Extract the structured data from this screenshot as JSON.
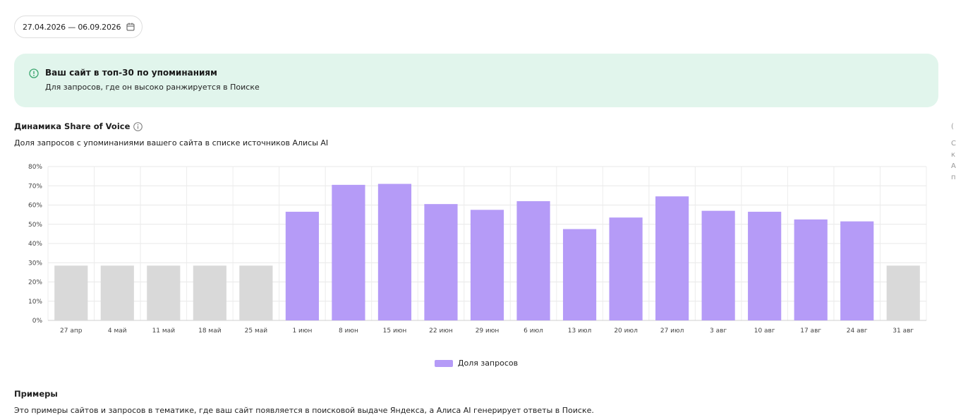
{
  "date_range": {
    "value": "27.04.2026 — 06.09.2026",
    "icon": "calendar-icon"
  },
  "alert": {
    "icon": "check-circle-icon",
    "title": "Ваш сайт в топ-30 по упоминаниям",
    "subtitle": "Для запросов, где он высоко ранжируется в Поиске",
    "background": "#e1f5ec",
    "accent": "#3aa56e"
  },
  "sov_section": {
    "title": "Динамика Share of Voice",
    "info_icon": "info-icon",
    "subtitle": "Доля запросов с упоминаниями вашего сайта в списке источников Алисы AI"
  },
  "chart_data": {
    "type": "bar",
    "categories": [
      "27 апр",
      "4 май",
      "11 май",
      "18 май",
      "25 май",
      "1 июн",
      "8 июн",
      "15 июн",
      "22 июн",
      "29 июн",
      "6 июл",
      "13 июл",
      "20 июл",
      "27 июл",
      "3 авг",
      "10 авг",
      "17 авг",
      "24 авг",
      "31 авг"
    ],
    "values": [
      28.5,
      28.5,
      28.5,
      28.5,
      28.5,
      56.5,
      70.5,
      71,
      60.5,
      57.5,
      62,
      47.5,
      53.5,
      64.5,
      57,
      56.5,
      52.5,
      51.5,
      28.5
    ],
    "highlighted": [
      false,
      false,
      false,
      false,
      false,
      true,
      true,
      true,
      true,
      true,
      true,
      true,
      true,
      true,
      true,
      true,
      true,
      true,
      false
    ],
    "ylim": [
      0,
      80
    ],
    "y_ticks": [
      "0%",
      "10%",
      "20%",
      "30%",
      "40%",
      "50%",
      "60%",
      "70%",
      "80%"
    ],
    "grid": true,
    "colors": {
      "series": "#b59bf7",
      "inactive": "#d9d9d9"
    },
    "legend": {
      "label": "Доля запросов",
      "placement": "bottom-center"
    }
  },
  "examples": {
    "title": "Примеры",
    "subtitle": "Это примеры сайтов и запросов в тематике, где ваш сайт появляется в поисковой выдаче Яндекса, а Алиса AI генерирует ответы в Поиске."
  },
  "side_panel": {
    "letters": [
      "(",
      "С",
      "к",
      "А",
      "п"
    ]
  }
}
